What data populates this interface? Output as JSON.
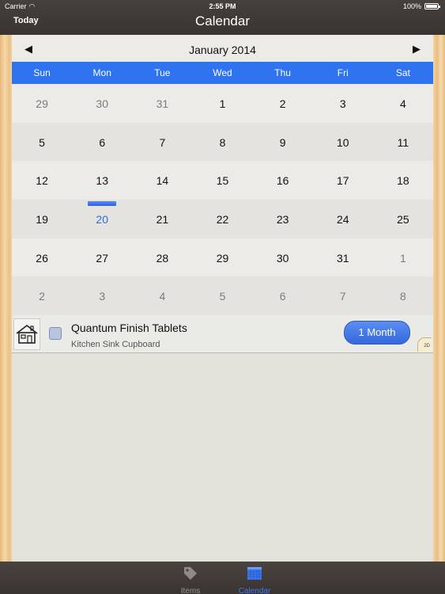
{
  "status_bar": {
    "carrier": "Carrier",
    "time": "2:55 PM",
    "battery": "100%"
  },
  "nav": {
    "title": "Calendar",
    "left_button": "Today"
  },
  "calendar": {
    "month_title": "January 2014",
    "prev_icon": "◀",
    "next_icon": "▶",
    "weekdays": [
      "Sun",
      "Mon",
      "Tue",
      "Wed",
      "Thu",
      "Fri",
      "Sat"
    ],
    "weeks": [
      [
        "29",
        "30",
        "31",
        "1",
        "2",
        "3",
        "4"
      ],
      [
        "5",
        "6",
        "7",
        "8",
        "9",
        "10",
        "11"
      ],
      [
        "12",
        "13",
        "14",
        "15",
        "16",
        "17",
        "18"
      ],
      [
        "19",
        "20",
        "21",
        "22",
        "23",
        "24",
        "25"
      ],
      [
        "26",
        "27",
        "28",
        "29",
        "30",
        "31",
        "1"
      ],
      [
        "2",
        "3",
        "4",
        "5",
        "6",
        "7",
        "8"
      ]
    ],
    "header_color": "#2f73f0"
  },
  "item": {
    "name": "Quantum Finish Tablets",
    "location": "Kitchen Sink Cupboard",
    "duration": "1 Month",
    "badge": "2D",
    "icon": "house-icon"
  },
  "tabs": [
    {
      "label": "Items",
      "icon": "tag-icon"
    },
    {
      "label": "Calendar",
      "icon": "calendar-icon"
    }
  ]
}
